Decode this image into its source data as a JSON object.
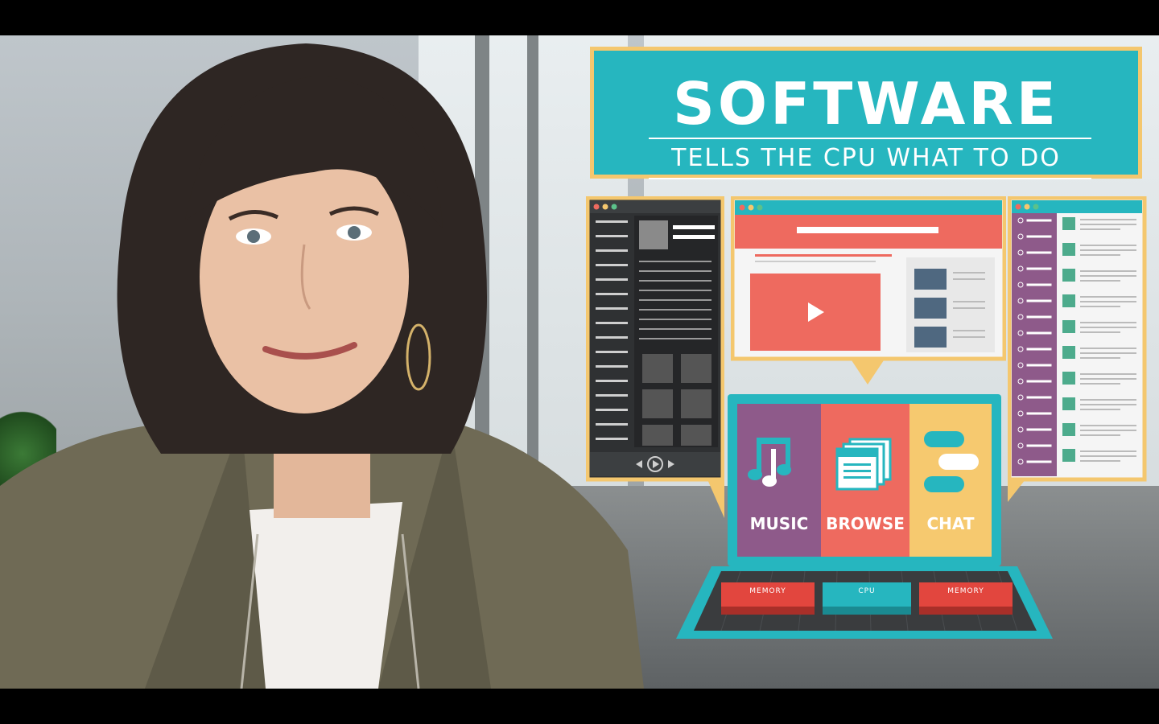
{
  "overlay": {
    "title": "SOFTWARE",
    "subtitle": "TELLS THE CPU WHAT TO DO"
  },
  "laptop": {
    "apps": [
      {
        "label": "MUSIC",
        "color": "#8e5a8a",
        "icon": "music-note-icon"
      },
      {
        "label": "BROWSE",
        "color": "#ee6a5f",
        "icon": "browser-windows-icon"
      },
      {
        "label": "CHAT",
        "color": "#f6c96f",
        "icon": "chat-bubbles-icon"
      }
    ],
    "keys": [
      {
        "label": "MEMORY",
        "color": "#e2463e"
      },
      {
        "label": "CPU",
        "color": "#26b6bf"
      },
      {
        "label": "MEMORY",
        "color": "#e2463e"
      }
    ]
  },
  "colors": {
    "teal": "#26b6bf",
    "gold": "#f4c76e",
    "coral": "#ee6a5f",
    "purple": "#8e5a8a",
    "dark": "#2f3133"
  }
}
